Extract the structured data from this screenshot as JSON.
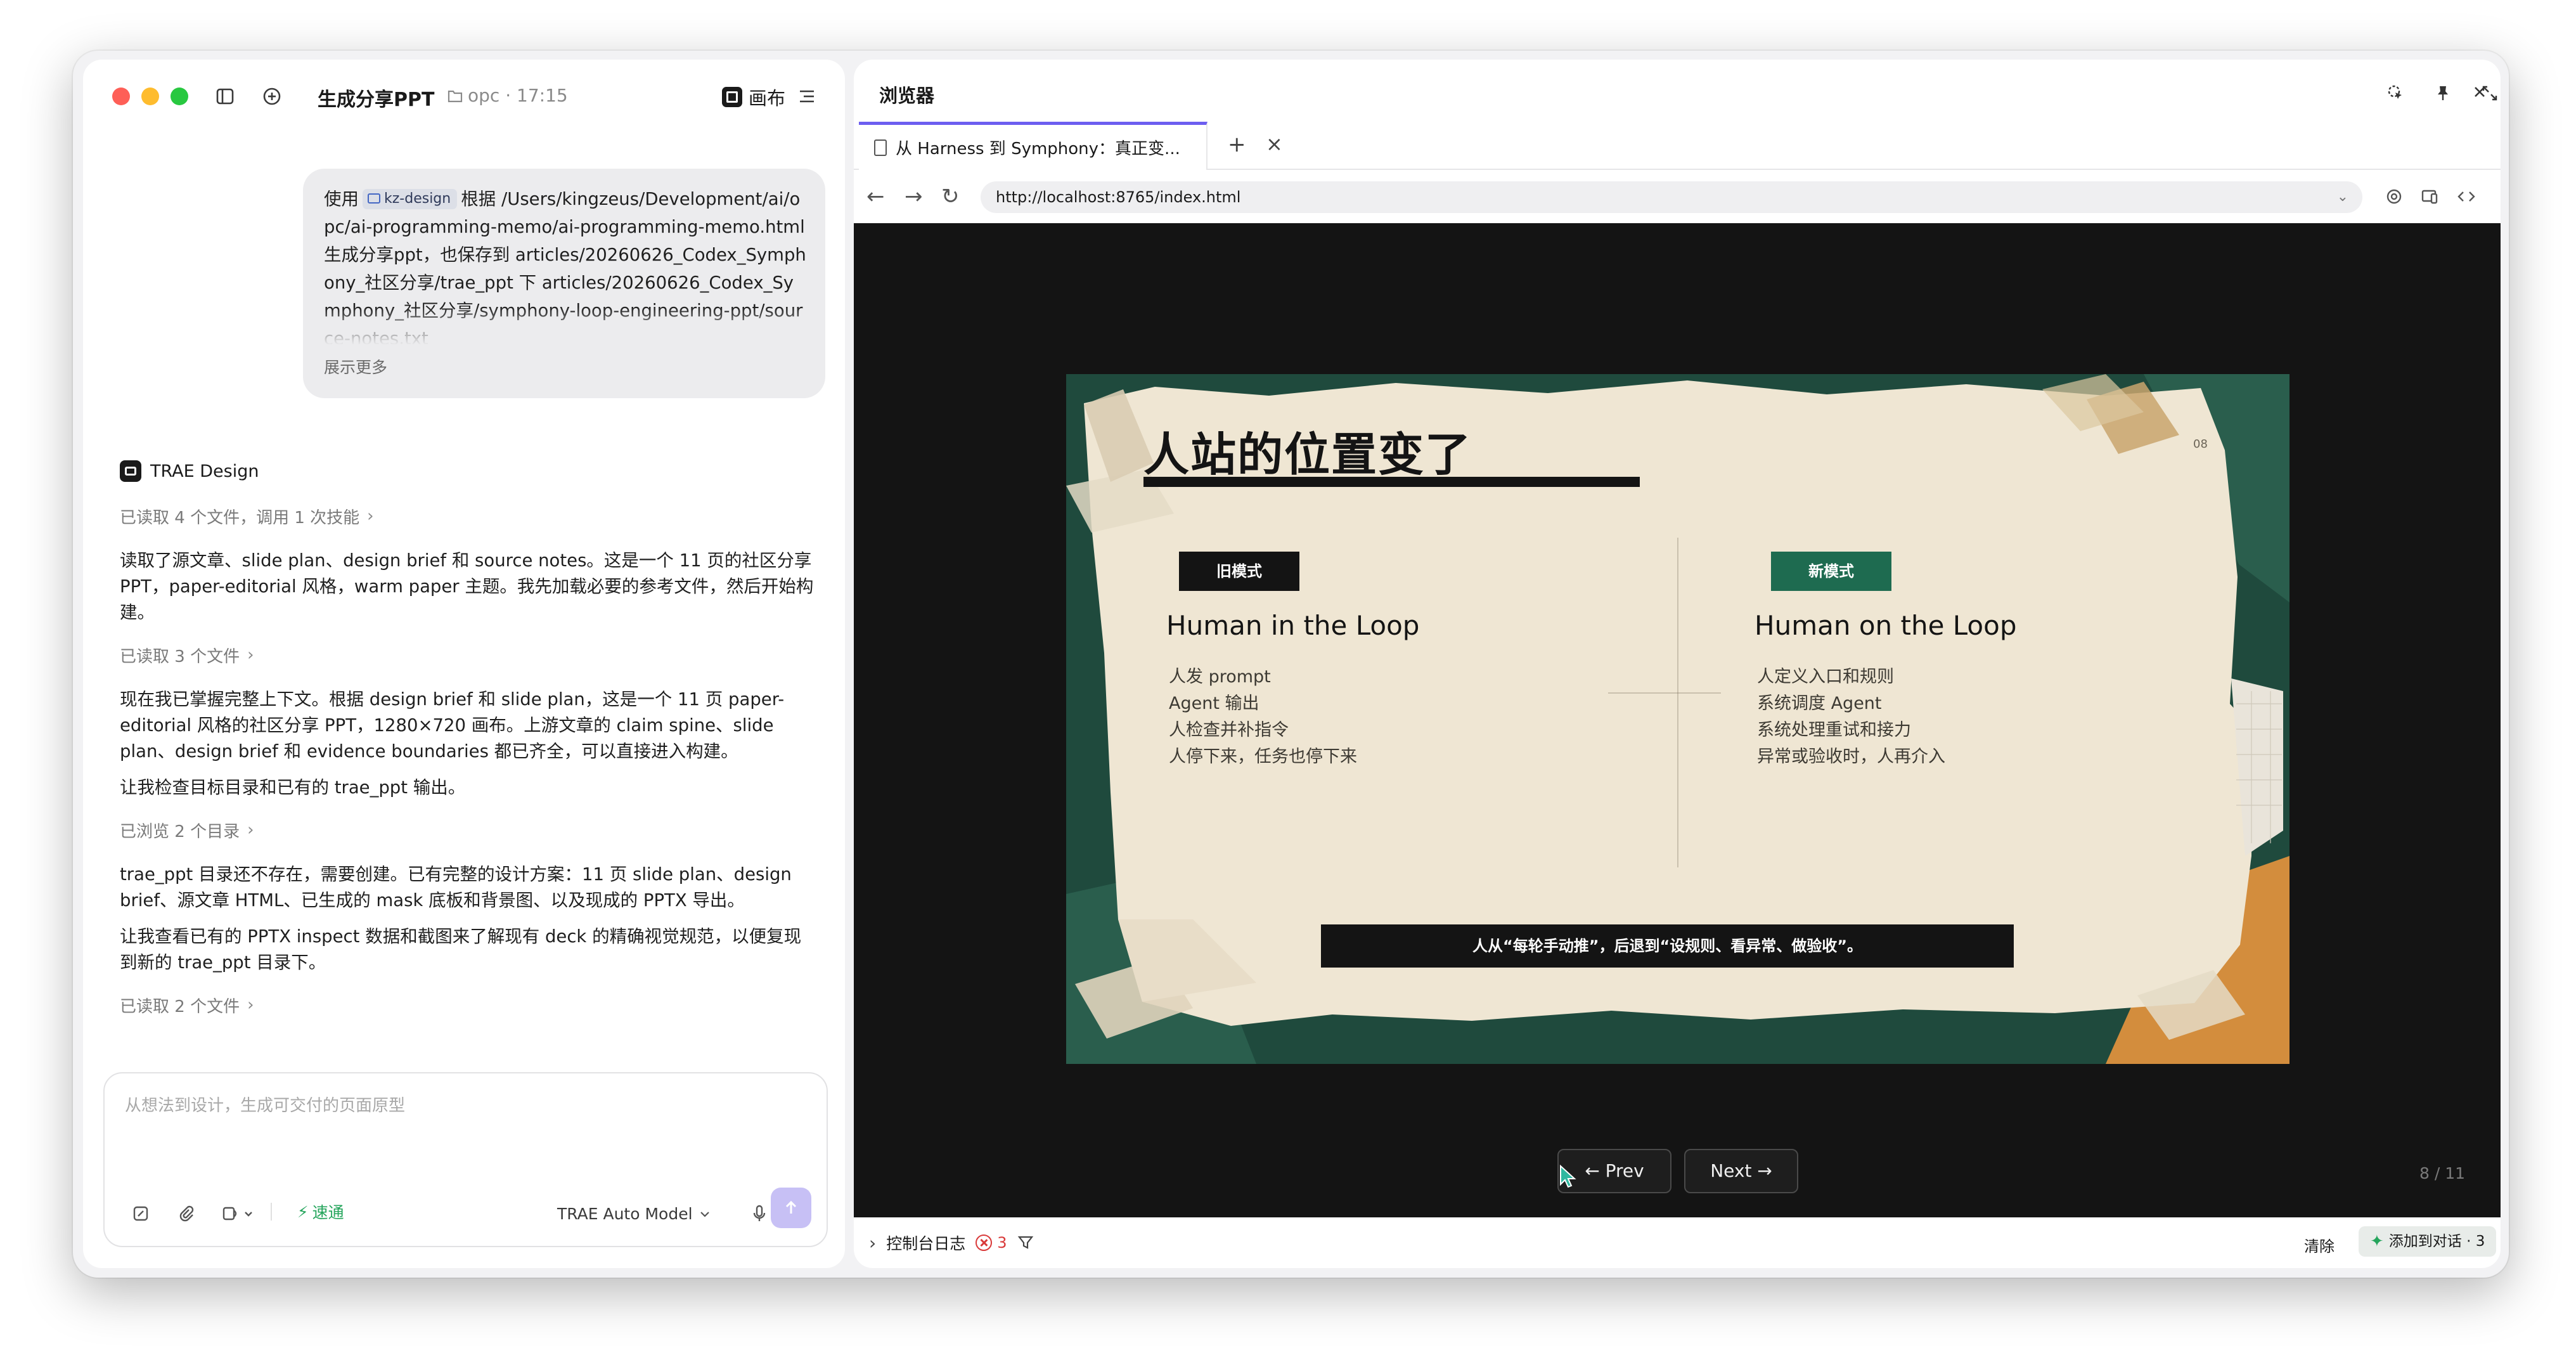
{
  "left_panel": {
    "title": "生成分享PPT",
    "project": "opc · 17:15",
    "canvas_label": "画布",
    "user_message": {
      "prefix": "使用",
      "chip": "kz-design",
      "body": "根据 /Users/kingzeus/Development/ai/opc/ai-programming-memo/ai-programming-memo.html 生成分享ppt，也保存到 articles/20260626_Codex_Symphony_社区分享/trae_ppt 下 articles/20260626_Codex_Symphony_社区分享/symphony-loop-engineering-ppt/source-notes.txt",
      "show_more": "展示更多"
    },
    "agent_name": "TRAE Design",
    "messages": [
      {
        "type": "meta",
        "text": "已读取 4 个文件，调用 1 次技能"
      },
      {
        "type": "para",
        "text": "读取了源文章、slide plan、design brief 和 source notes。这是一个 11 页的社区分享 PPT，paper-editorial 风格，warm paper 主题。我先加载必要的参考文件，然后开始构建。"
      },
      {
        "type": "meta",
        "text": "已读取 3 个文件"
      },
      {
        "type": "para",
        "text": "现在我已掌握完整上下文。根据 design brief 和 slide plan，这是一个 11 页 paper-editorial 风格的社区分享 PPT，1280×720 画布。上游文章的 claim spine、slide plan、design brief 和 evidence boundaries 都已齐全，可以直接进入构建。"
      },
      {
        "type": "para",
        "text": "让我检查目标目录和已有的 trae_ppt 输出。"
      },
      {
        "type": "meta",
        "text": "已浏览 2 个目录"
      },
      {
        "type": "para",
        "text": "trae_ppt 目录还不存在，需要创建。已有完整的设计方案：11 页 slide plan、design brief、源文章 HTML、已生成的 mask 底板和背景图、以及现成的 PPTX 导出。"
      },
      {
        "type": "para",
        "text": "让我查看已有的 PPTX inspect 数据和截图来了解现有 deck 的精确视觉规范，以便复现到新的 trae_ppt 目录下。"
      },
      {
        "type": "meta",
        "text": "已读取 2 个文件"
      }
    ],
    "input_placeholder": "从想法到设计，生成可交付的页面原型",
    "speed_label": "速通",
    "model_label": "TRAE Auto Model"
  },
  "browser": {
    "title": "浏览器",
    "tab_title": "从 Harness 到 Symphony：真正变...",
    "url": "http://localhost:8765/index.html",
    "slide": {
      "title": "人站的位置变了",
      "page_num": "08",
      "left": {
        "badge": "旧模式",
        "heading": "Human in the Loop",
        "items": [
          "人发 prompt",
          "Agent 输出",
          "人检查并补指令",
          "人停下来，任务也停下来"
        ]
      },
      "right": {
        "badge": "新模式",
        "heading": "Human on the Loop",
        "items": [
          "人定义入口和规则",
          "系统调度 Agent",
          "系统处理重试和接力",
          "异常或验收时，人再介入"
        ]
      },
      "bottom_bar": "人从“每轮手动推”，后退到“设规则、看异常、做验收”。"
    },
    "prev_label": "← Prev",
    "next_label": "Next →",
    "page_counter": "8 / 11",
    "console_label": "控制台日志",
    "error_count": "3",
    "clear_label": "清除",
    "add_to_chat_label": "添加到对话 · 3"
  },
  "colors": {
    "accent_purple": "#6d5ef0",
    "send_button": "#c7c0f5",
    "slide_green": "#1e6b50",
    "paper": "#efe6d3",
    "error_red": "#d93a3a",
    "speed_green": "#25a55c"
  }
}
